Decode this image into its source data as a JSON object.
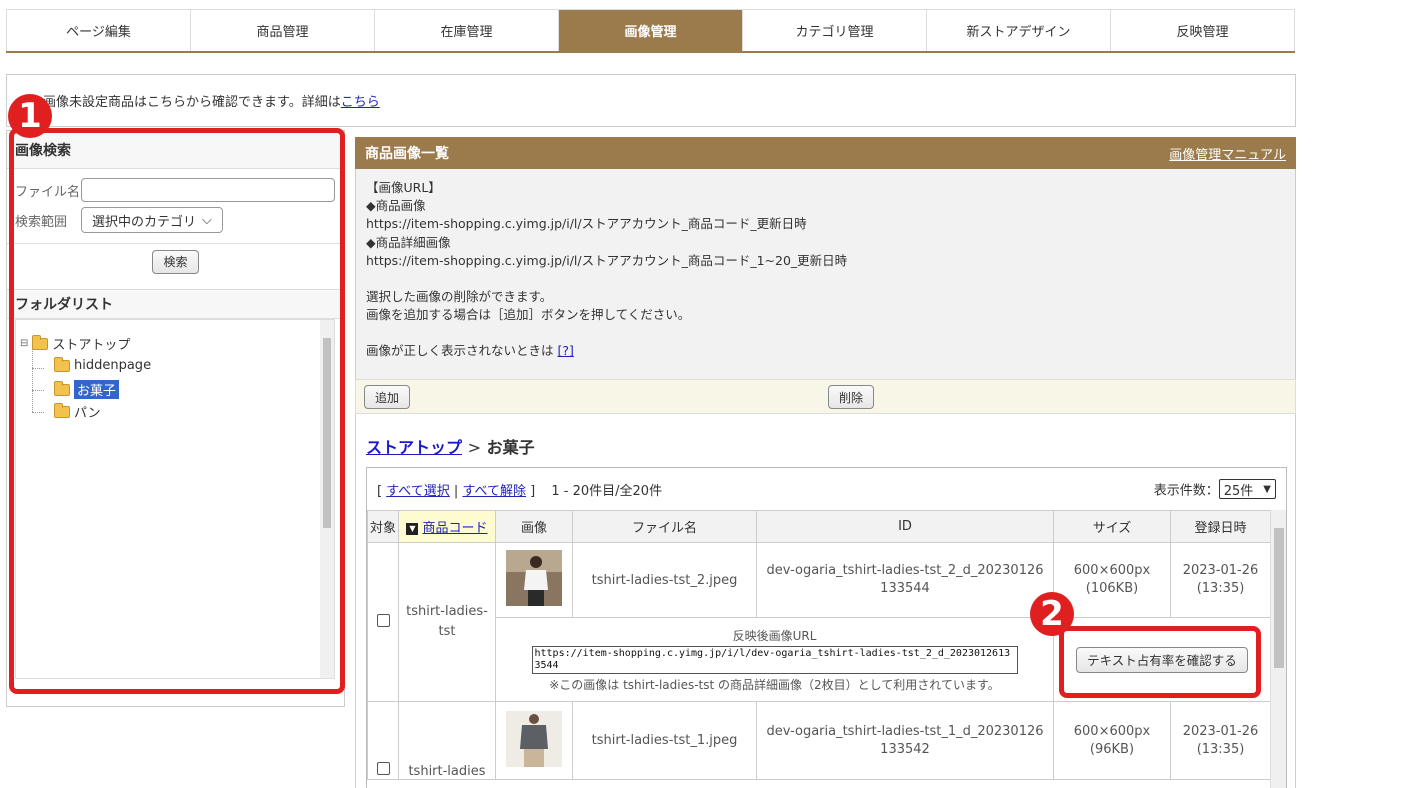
{
  "nav": {
    "tabs": [
      "ページ編集",
      "商品管理",
      "在庫管理",
      "画像管理",
      "カテゴリ管理",
      "新ストアデザイン",
      "反映管理"
    ],
    "active_index": 3
  },
  "notice": {
    "text": "画像未設定商品はこちらから確認できます。詳細は",
    "link": "こちら"
  },
  "search": {
    "heading": "画像検索",
    "filename_label": "ファイル名",
    "filename_value": "",
    "scope_label": "検索範囲",
    "scope_value": "選択中のカテゴリ",
    "search_button": "検索"
  },
  "folders": {
    "heading": "フォルダリスト",
    "root": "ストアトップ",
    "items": [
      "hiddenpage",
      "お菓子",
      "パン"
    ],
    "selected": "お菓子"
  },
  "annotations": {
    "badge1": "1",
    "badge2": "2"
  },
  "panel": {
    "title": "商品画像一覧",
    "manual_link": "画像管理マニュアル",
    "info_lines": [
      "【画像URL】",
      "◆商品画像",
      "https://item-shopping.c.yimg.jp/i/l/ストアアカウント_商品コード_更新日時",
      "◆商品詳細画像",
      "https://item-shopping.c.yimg.jp/i/l/ストアアカウント_商品コード_1~20_更新日時",
      "",
      "選択した画像の削除ができます。",
      "画像を追加する場合は［追加］ボタンを押してください。",
      "",
      "画像が正しく表示されないときは"
    ],
    "help_link": "[?]",
    "add_button": "追加",
    "delete_button": "削除"
  },
  "breadcrumb": {
    "root": "ストアトップ",
    "separator": ">",
    "current": "お菓子"
  },
  "list": {
    "select_all": "すべて選択",
    "deselect_all": "すべて解除",
    "count_text": "1 - 20件目/全20件",
    "per_page_label": "表示件数：",
    "per_page_value": "25件",
    "columns": [
      "対象",
      "商品コード",
      "画像",
      "ファイル名",
      "ID",
      "サイズ",
      "登録日時"
    ],
    "rows": [
      {
        "code": "tshirt-ladies-tst",
        "filename": "tshirt-ladies-tst_2.jpeg",
        "id_line1": "dev-ogaria_tshirt-ladies-tst_2_d_20230126",
        "id_line2": "133544",
        "size_line1": "600×600px",
        "size_line2": "(106KB)",
        "date_line1": "2023-01-26",
        "date_line2": "(13:35)",
        "url_label": "反映後画像URL",
        "url_value": "https://item-shopping.c.yimg.jp/i/l/dev-ogaria_tshirt-ladies-tst_2_d_20230126133544",
        "usage_note": "※この画像は tshirt-ladies-tst の商品詳細画像（2枚目）として利用されています。",
        "check_button": "テキスト占有率を確認する"
      },
      {
        "code": "tshirt-ladies",
        "filename": "tshirt-ladies-tst_1.jpeg",
        "id_line1": "dev-ogaria_tshirt-ladies-tst_1_d_20230126",
        "id_line2": "133542",
        "size_line1": "600×600px",
        "size_line2": "(96KB)",
        "date_line1": "2023-01-26",
        "date_line2": "(13:35)"
      }
    ]
  }
}
